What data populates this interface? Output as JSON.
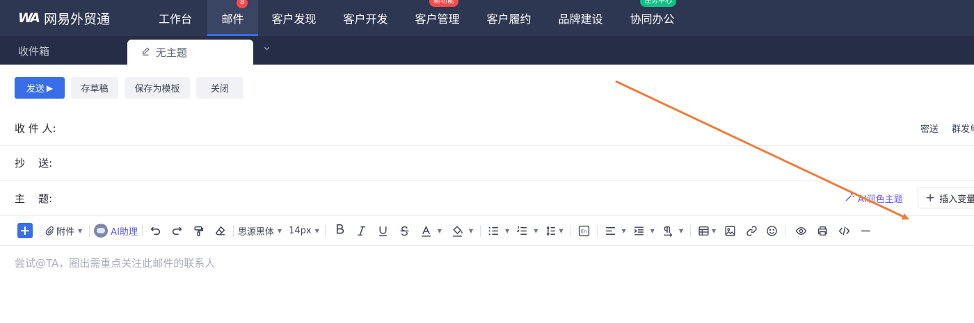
{
  "app": {
    "logo_mark": "WA",
    "name": "网易外贸通"
  },
  "nav": {
    "items": [
      {
        "label": "工作台",
        "badge": "",
        "badge_color": ""
      },
      {
        "label": "邮件",
        "badge": "8",
        "badge_color": "red",
        "active": true
      },
      {
        "label": "客户发现",
        "badge": "",
        "badge_color": ""
      },
      {
        "label": "客户开发",
        "badge": "",
        "badge_color": ""
      },
      {
        "label": "客户管理",
        "badge": "新功能",
        "badge_color": "red"
      },
      {
        "label": "客户履约",
        "badge": "",
        "badge_color": ""
      },
      {
        "label": "品牌建设",
        "badge": "",
        "badge_color": ""
      },
      {
        "label": "协同办公",
        "badge": "任务中心",
        "badge_color": "green"
      }
    ]
  },
  "tabs": {
    "inbox": "收件箱",
    "compose": "无主题",
    "more_icon": "chevron-down-icon"
  },
  "actions": {
    "send": "发送",
    "save_draft": "存草稿",
    "save_template": "保存为模板",
    "close": "关闭"
  },
  "form": {
    "to_label": "收 件 人:",
    "cc_label": "抄    送:",
    "subject_label": "主    题:",
    "bcc_link": "密送",
    "group_send_link": "群发单",
    "ai_polish_subject": "AI润色主题",
    "insert_variable": "插入变量"
  },
  "toolbar": {
    "attachment": "附件",
    "ai_assistant": "AI助理",
    "font_family": "思源黑体",
    "font_size": "14px"
  },
  "editor": {
    "placeholder": "尝试@TA，圈出需重点关注此邮件的联系人"
  },
  "colors": {
    "nav_bg": "#2e3752",
    "tabbar_bg": "#252d47",
    "accent": "#386ee7",
    "annotation_arrow": "#f07a3a"
  }
}
